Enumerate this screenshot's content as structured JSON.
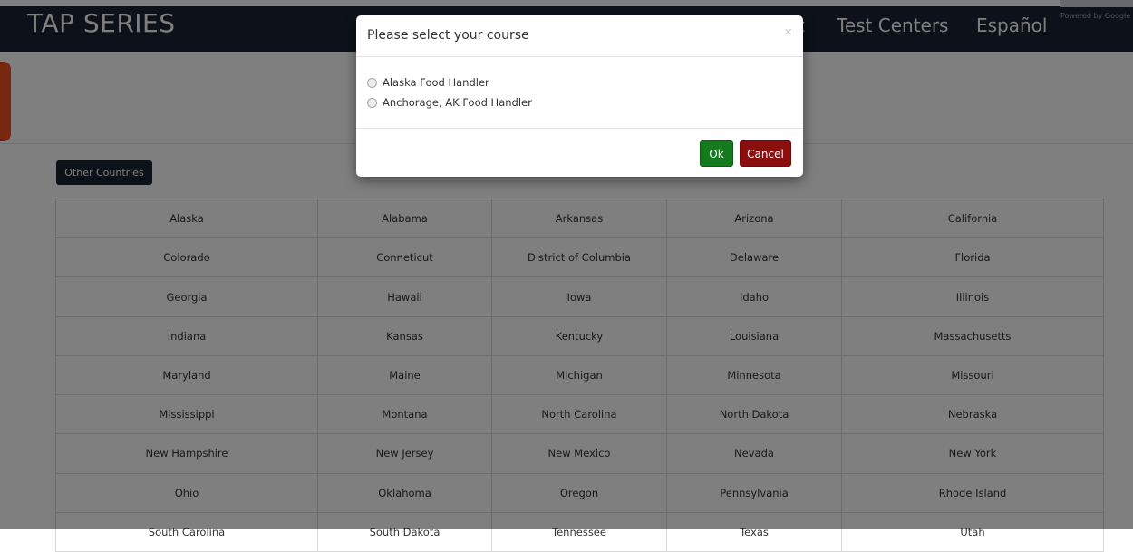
{
  "navbar": {
    "brand": "TAP SERIES",
    "links": [
      "t",
      "Test Centers",
      "Español"
    ],
    "translate_credit": "Powered by Google"
  },
  "other_countries_label": "Other Countries",
  "states": [
    [
      "Alaska",
      "Alabama",
      "Arkansas",
      "Arizona",
      "California"
    ],
    [
      "Colorado",
      "Conneticut",
      "District of Columbia",
      "Delaware",
      "Florida"
    ],
    [
      "Georgia",
      "Hawaii",
      "Iowa",
      "Idaho",
      "Illinois"
    ],
    [
      "Indiana",
      "Kansas",
      "Kentucky",
      "Louisiana",
      "Massachusetts"
    ],
    [
      "Maryland",
      "Maine",
      "Michigan",
      "Minnesota",
      "Missouri"
    ],
    [
      "Mississippi",
      "Montana",
      "North Carolina",
      "North Dakota",
      "Nebraska"
    ],
    [
      "New Hampshire",
      "New Jersey",
      "New Mexico",
      "Nevada",
      "New York"
    ],
    [
      "Ohio",
      "Oklahoma",
      "Oregon",
      "Pennsylvania",
      "Rhode Island"
    ],
    [
      "South Carolina",
      "South Dakota",
      "Tennessee",
      "Texas",
      "Utah"
    ]
  ],
  "modal": {
    "title": "Please select your course",
    "close": "×",
    "options": [
      "Alaska Food Handler",
      "Anchorage, AK Food Handler"
    ],
    "ok_label": "Ok",
    "cancel_label": "Cancel"
  },
  "colors": {
    "navbar_bg": "#1b2333",
    "accent_tab": "#f04e23",
    "ok_button": "#157a1e",
    "cancel_button": "#8a1010"
  }
}
